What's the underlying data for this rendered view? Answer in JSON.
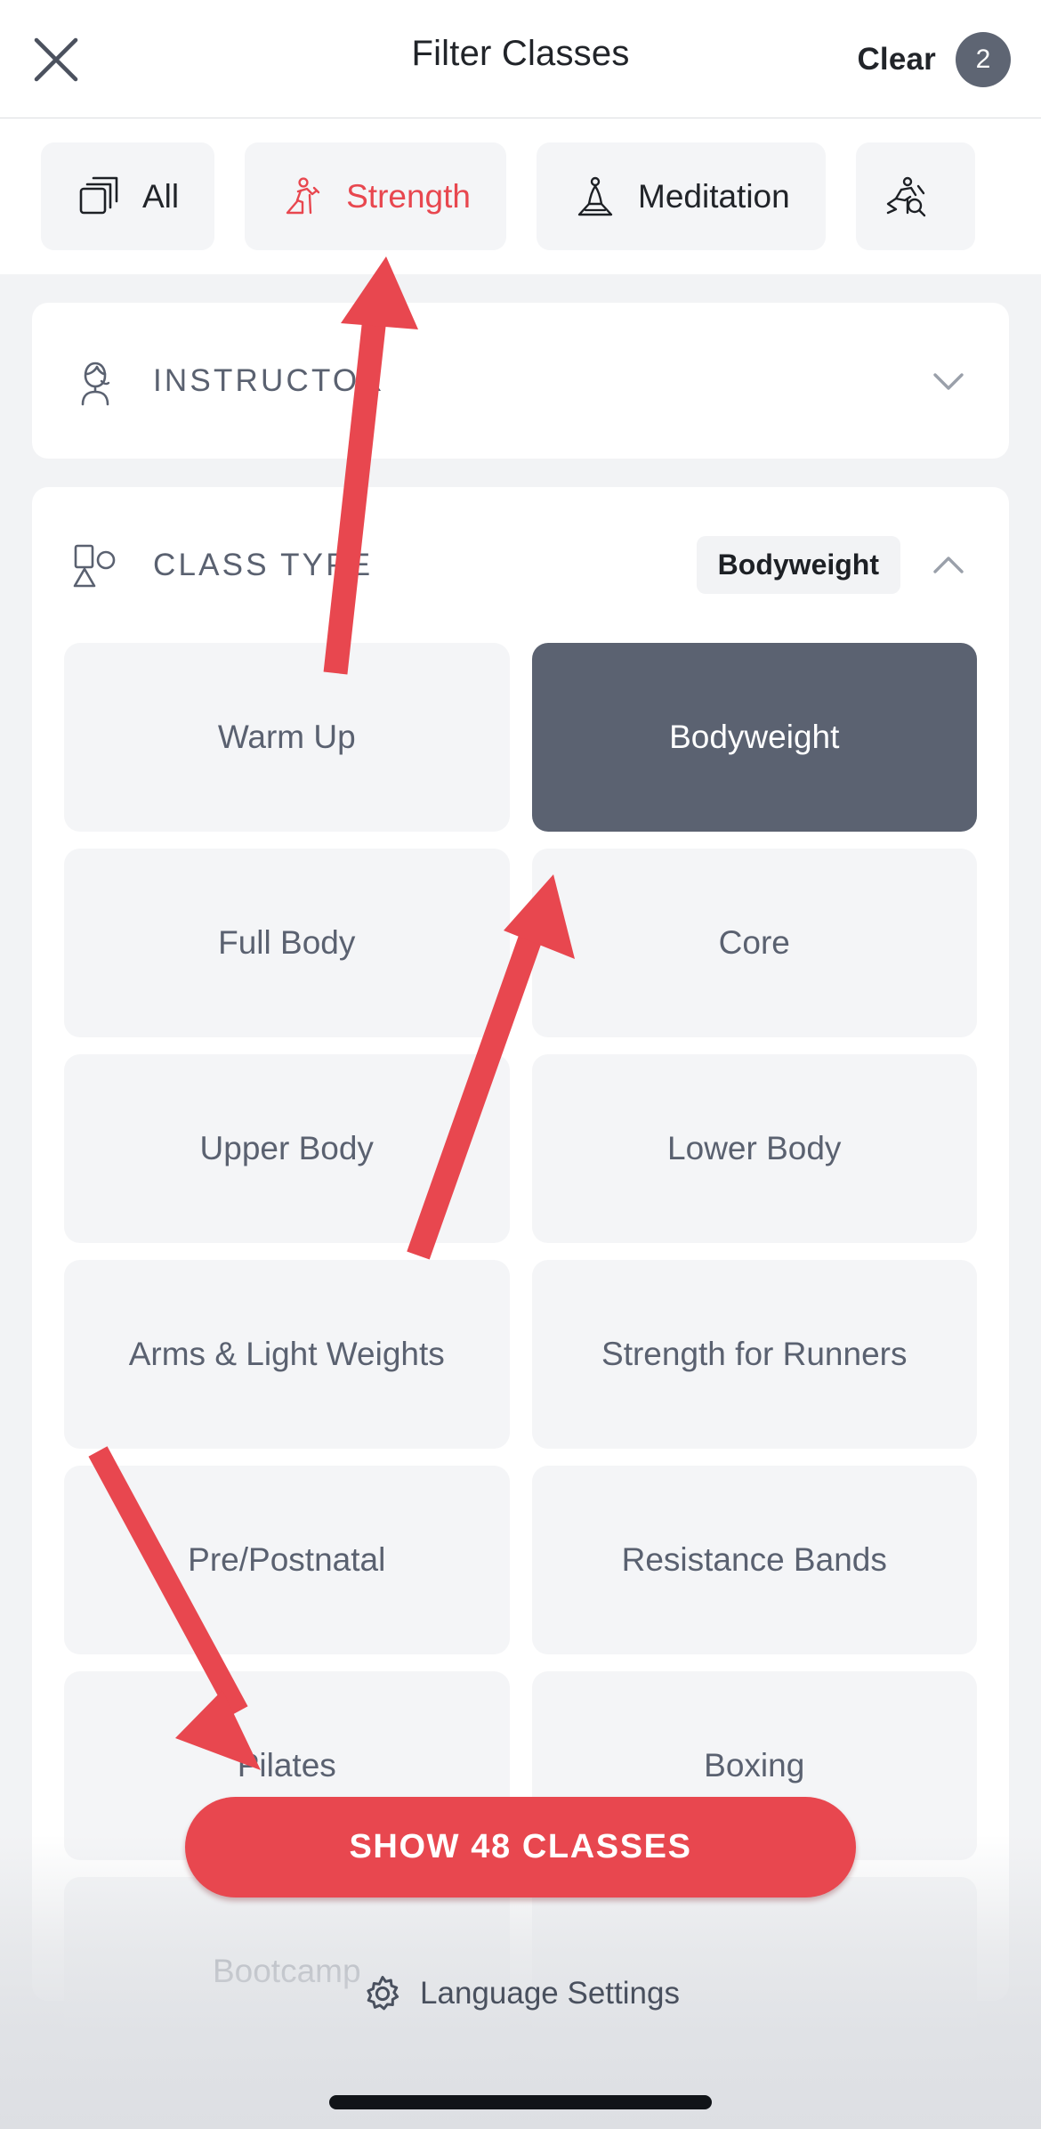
{
  "header": {
    "title": "Filter Classes",
    "clear_label": "Clear",
    "clear_badge_count": "2",
    "close_icon": "close-icon"
  },
  "tabs": [
    {
      "label": "All",
      "icon": "layers-icon",
      "active": false
    },
    {
      "label": "Strength",
      "icon": "runner-icon",
      "active": true
    },
    {
      "label": "Meditation",
      "icon": "lotus-icon",
      "active": false
    },
    {
      "label": "",
      "icon": "cycling-icon",
      "active": false
    }
  ],
  "sections": [
    {
      "title": "INSTRUCTOR",
      "icon": "instructor-icon",
      "chip": "",
      "expanded": false,
      "chevron": "chevron-down-icon"
    },
    {
      "title": "CLASS TYPE",
      "icon": "shapes-icon",
      "chip": "Bodyweight",
      "expanded": true,
      "chevron": "chevron-up-icon"
    }
  ],
  "class_types": [
    {
      "label": "Warm Up",
      "selected": false
    },
    {
      "label": "Bodyweight",
      "selected": true
    },
    {
      "label": "Full Body",
      "selected": false
    },
    {
      "label": "Core",
      "selected": false
    },
    {
      "label": "Upper Body",
      "selected": false
    },
    {
      "label": "Lower Body",
      "selected": false
    },
    {
      "label": "Arms & Light Weights",
      "selected": false
    },
    {
      "label": "Strength for Runners",
      "selected": false
    },
    {
      "label": "Pre/Postnatal",
      "selected": false
    },
    {
      "label": "Resistance Bands",
      "selected": false
    },
    {
      "label": "Pilates",
      "selected": false
    },
    {
      "label": "Boxing",
      "selected": false
    },
    {
      "label": "Bootcamp",
      "selected": false
    }
  ],
  "cta": {
    "label": "SHOW 48 CLASSES"
  },
  "footer": {
    "language_label": "Language Settings",
    "gear_icon": "gear-icon"
  },
  "colors": {
    "accent_red": "#e8474f",
    "selected_slate": "#5b6271",
    "badge_slate": "#5e6573",
    "page_bg": "#f2f3f5",
    "tile_bg": "#f4f5f7",
    "text_dark": "#212429",
    "text_muted": "#5a6170"
  },
  "annotations": [
    {
      "name": "arrow-to-strength-tab",
      "target": "Strength"
    },
    {
      "name": "arrow-to-bodyweight-tile",
      "target": "Bodyweight"
    },
    {
      "name": "arrow-to-show-classes",
      "target": "SHOW 48 CLASSES"
    }
  ]
}
